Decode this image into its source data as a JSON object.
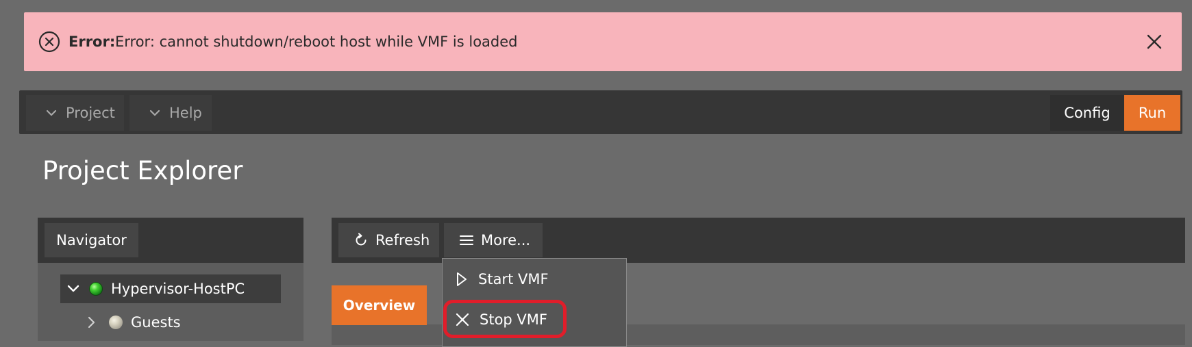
{
  "alert": {
    "title": "Error:",
    "message": "Error: cannot shutdown/reboot host while VMF is loaded",
    "icon": "error-circle-icon",
    "close_icon": "close-icon",
    "background": "#f8b4bb"
  },
  "topbar": {
    "project_label": "Project",
    "help_label": "Help",
    "config_label": "Config",
    "run_label": "Run",
    "accent": "#e8732a"
  },
  "page": {
    "title": "Project Explorer"
  },
  "navigator": {
    "tab_label": "Navigator",
    "tree": [
      {
        "label": "Hypervisor-HostPC",
        "expanded": true,
        "status": "green"
      },
      {
        "label": "Guests",
        "expanded": false,
        "status": "grey"
      }
    ]
  },
  "toolbar": {
    "refresh_label": "Refresh",
    "more_label": "More..."
  },
  "dropdown": {
    "items": [
      {
        "label": "Start VMF",
        "icon": "play-outline-icon"
      },
      {
        "label": "Stop VMF",
        "icon": "x-icon",
        "highlighted": true
      }
    ]
  },
  "tabs": {
    "overview_label": "Overview"
  }
}
